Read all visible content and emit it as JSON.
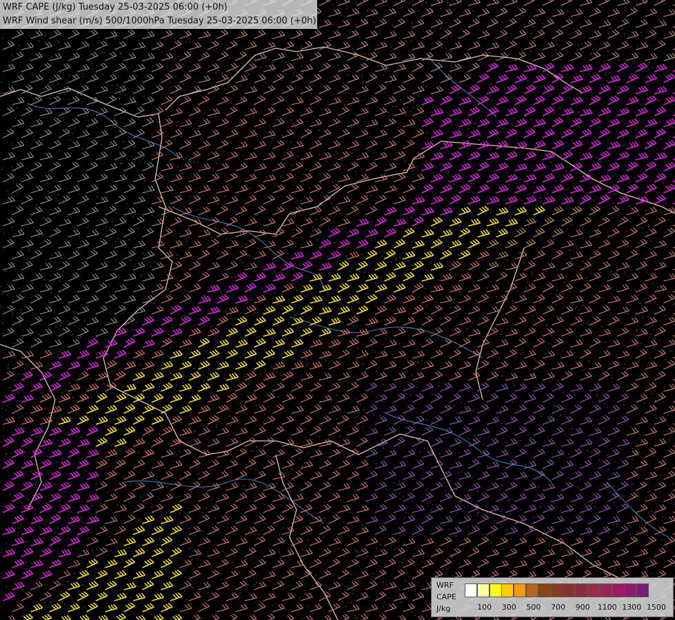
{
  "title": {
    "line1": "WRF CAPE (J/kg) Tuesday 25-03-2025 06:00 (+0h)",
    "line2": "WRF Wind shear (m/s) 500/1000hPa Tuesday 25-03-2025 06:00 (+0h)"
  },
  "legend": {
    "name_lines": [
      "WRF",
      "CAPE",
      "J/kg"
    ],
    "colors": [
      "#ffffff",
      "#ffff99",
      "#ffff00",
      "#ffcc00",
      "#f39c12",
      "#b8651b",
      "#8b4513",
      "#8b3a1f",
      "#8b3030",
      "#8f2a3a",
      "#992a48",
      "#9c2258",
      "#9c1a66",
      "#901a72",
      "#7d1a7a"
    ],
    "tick_labels": [
      "100",
      "300",
      "500",
      "700",
      "900",
      "1100",
      "1300",
      "1500"
    ]
  },
  "map": {
    "background": "#000000",
    "barb_colors": {
      "grey": "#9a9a9a",
      "light": "#c98f85",
      "salmon": "#d9837a",
      "coral": "#ff7f6e",
      "magenta": "#e020e0",
      "yellow": "#f0e020",
      "tan": "#c9a064",
      "violet": "#a060c0"
    },
    "border_color": "#e6c6a8",
    "river_color": "#4a7ab8"
  }
}
